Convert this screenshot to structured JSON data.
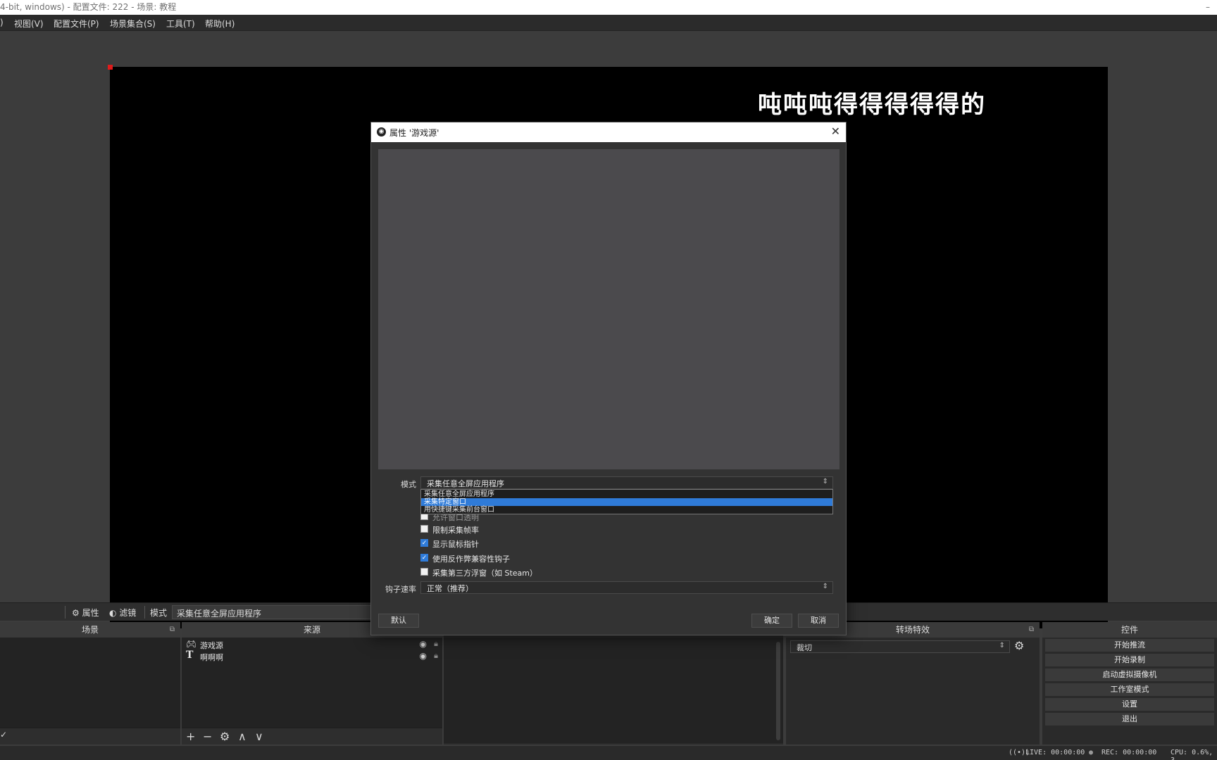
{
  "window": {
    "title": "4-bit, windows) - 配置文件: 222 - 场景: 教程",
    "minimize": "–"
  },
  "menu": [
    "视图(V)",
    "配置文件(P)",
    "场景集合(S)",
    "工具(T)",
    "帮助(H)"
  ],
  "menu_lead": ")",
  "preview": {
    "text": "吨吨吨得得得得得的"
  },
  "source_toolbar": {
    "properties": "属性",
    "filters": "滤镜",
    "mode_label": "模式",
    "mode_value": "采集任意全屏应用程序"
  },
  "docks": {
    "scenes": {
      "title": "场景"
    },
    "sources": {
      "title": "来源",
      "items": [
        {
          "name": "游戏源",
          "icon": "gamepad-icon"
        },
        {
          "name": "啊啊啊",
          "icon": "text-icon"
        }
      ],
      "footer": [
        "+",
        "−",
        "⚙",
        "∧",
        "∨"
      ]
    },
    "transitions": {
      "title": "转场特效",
      "value": "裁切"
    },
    "controls": {
      "title": "控件",
      "buttons": [
        "开始推流",
        "开始录制",
        "启动虚拟摄像机",
        "工作室模式",
        "设置",
        "退出"
      ]
    }
  },
  "status": {
    "live": "LIVE: 00:00:00",
    "rec": "REC: 00:00:00",
    "cpu": "CPU: 0.6%, 3"
  },
  "dialog": {
    "title": "属性 '游戏源'",
    "mode_label": "模式",
    "mode_value": "采集任意全屏应用程序",
    "mode_options": [
      "采集任意全屏应用程序",
      "采集特定窗口",
      "用快捷键采集前台窗口"
    ],
    "hidden_option": "允许窗口透明",
    "checkboxes": [
      {
        "label": "限制采集帧率",
        "checked": false
      },
      {
        "label": "显示鼠标指针",
        "checked": true
      },
      {
        "label": "使用反作弊兼容性钩子",
        "checked": true
      },
      {
        "label": "采集第三方浮窗（如 Steam）",
        "checked": false
      }
    ],
    "hook_label": "钩子速率",
    "hook_value": "正常（推荐）",
    "buttons": {
      "default": "默认",
      "ok": "确定",
      "cancel": "取消"
    }
  }
}
